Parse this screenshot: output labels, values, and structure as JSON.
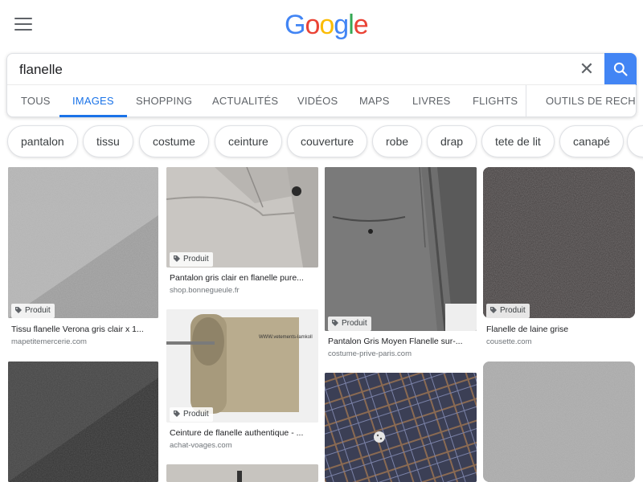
{
  "header": {
    "logo_letters": [
      "G",
      "o",
      "o",
      "g",
      "l",
      "e"
    ],
    "logo_colors": [
      "#4285f4",
      "#ea4335",
      "#fbbc05",
      "#4285f4",
      "#34a853",
      "#ea4335"
    ]
  },
  "search": {
    "query": "flanelle",
    "placeholder": ""
  },
  "tabs": [
    {
      "label": "TOUS"
    },
    {
      "label": "IMAGES"
    },
    {
      "label": "SHOPPING"
    },
    {
      "label": "ACTUALITÉS"
    },
    {
      "label": "VIDÉOS"
    },
    {
      "label": "MAPS"
    },
    {
      "label": "LIVRES"
    },
    {
      "label": "FLIGHTS"
    },
    {
      "label": "OUTILS DE RECHE"
    }
  ],
  "chips": [
    {
      "label": "pantalon"
    },
    {
      "label": "tissu"
    },
    {
      "label": "costume"
    },
    {
      "label": "ceinture"
    },
    {
      "label": "couverture"
    },
    {
      "label": "robe"
    },
    {
      "label": "drap"
    },
    {
      "label": "tete de lit"
    },
    {
      "label": "canapé"
    }
  ],
  "results": [
    {
      "badge": "Produit",
      "title": "Tissu flanelle Verona gris clair x 1...",
      "source": "mapetitemercerie.com"
    },
    {
      "badge": "Produit",
      "title": "Pantalon gris clair en flanelle pure...",
      "source": "shop.bonnegueule.fr"
    },
    {
      "badge": "Produit",
      "title": "Pantalon Gris Moyen Flanelle sur-...",
      "source": "costume-prive-paris.com"
    },
    {
      "badge": "Produit",
      "title": "Flanelle de laine grise",
      "source": "cousette.com"
    },
    {
      "badge": "Produit",
      "title": "Ceinture de flanelle authentique - ...",
      "source": "achat-voages.com",
      "watermark": "WWW.vetements-lamkoll"
    }
  ],
  "colors": {
    "accent": "#1a73e8",
    "search_button": "#4285f4"
  }
}
